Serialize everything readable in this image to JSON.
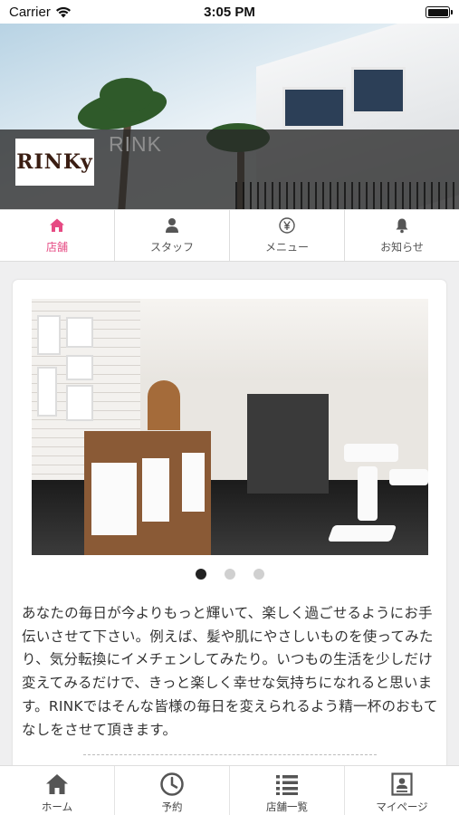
{
  "status_bar": {
    "carrier": "Carrier",
    "time": "3:05 PM"
  },
  "header": {
    "brand": "RINK",
    "logo_text": "RINKy"
  },
  "tabs": [
    {
      "label": "店舗",
      "icon": "home-icon",
      "active": true
    },
    {
      "label": "スタッフ",
      "icon": "person-icon",
      "active": false
    },
    {
      "label": "メニュー",
      "icon": "yen-icon",
      "active": false
    },
    {
      "label": "お知らせ",
      "icon": "bell-icon",
      "active": false
    }
  ],
  "carousel": {
    "slide_count": 3,
    "active_index": 0
  },
  "description": "あなたの毎日が今よりもっと輝いて、楽しく過ごせるようにお手伝いさせて下さい。例えば、髪や肌にやさしいものを使ってみたり、気分転換にイメチェンしてみたり。いつもの生活を少しだけ変えてみるだけで、きっと楽しく幸せな気持ちになれると思います。RINKではそんな皆様の毎日を変えられるよう精一杯のおもてなしをさせて頂きます。",
  "bottom_nav": [
    {
      "label": "ホーム",
      "icon": "home-icon"
    },
    {
      "label": "予約",
      "icon": "clock-icon"
    },
    {
      "label": "店舗一覧",
      "icon": "list-icon"
    },
    {
      "label": "マイページ",
      "icon": "profile-card-icon"
    }
  ],
  "colors": {
    "accent": "#e64a83",
    "text": "#333333",
    "background": "#efeff0"
  }
}
